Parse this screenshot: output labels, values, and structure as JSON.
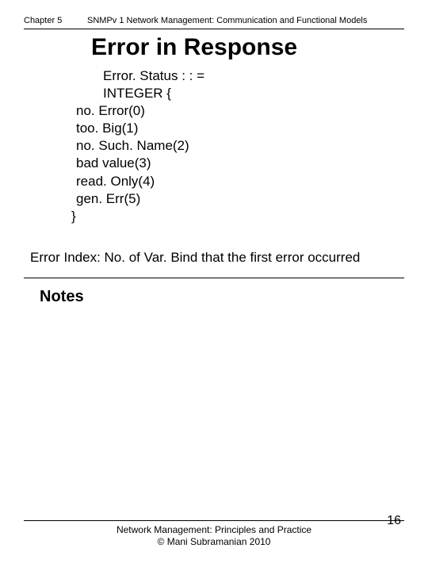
{
  "header": {
    "chapter": "Chapter 5",
    "title": "SNMPv 1 Network Management: Communication and Functional Models"
  },
  "main": {
    "title": "Error in Response"
  },
  "asn": {
    "line1": "Error. Status : : =",
    "line2": "INTEGER {",
    "item0": "no. Error(0)",
    "item1": "too. Big(1)",
    "item2": "no. Such. Name(2)",
    "item3": "bad value(3)",
    "item4": "read. Only(4)",
    "item5": "gen. Err(5)",
    "close": "}"
  },
  "error_index": "Error Index: No. of Var. Bind that the first error occurred",
  "notes": {
    "label": "Notes"
  },
  "footer": {
    "line1": "Network Management: Principles and Practice",
    "line2": "© Mani Subramanian 2010",
    "page_number": "16"
  }
}
